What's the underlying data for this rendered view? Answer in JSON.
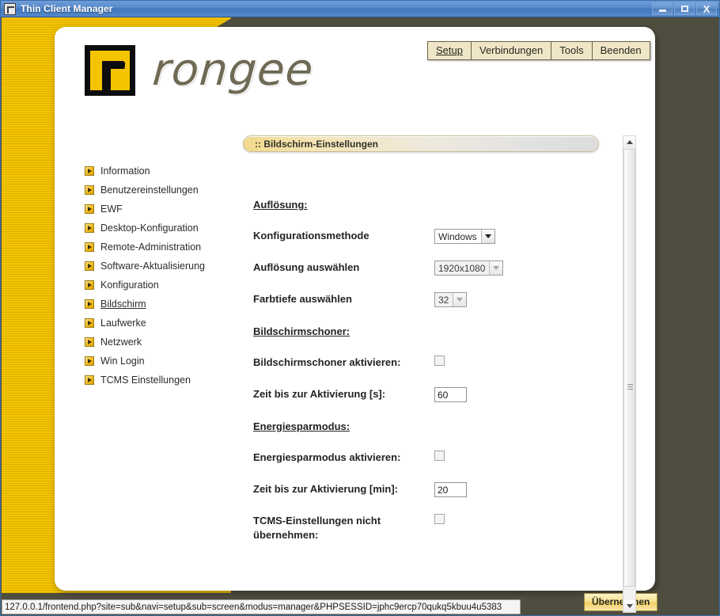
{
  "window": {
    "title": "Thin Client Manager",
    "icon": "app-logo-icon",
    "controls": {
      "minimize": "minimize-icon",
      "maximize": "maximize-icon",
      "close": "X"
    }
  },
  "brand": {
    "logo_text": "rongee",
    "logo_mark": "rongee-r-mark"
  },
  "top_menu": [
    {
      "label": "Setup",
      "active": true
    },
    {
      "label": "Verbindungen",
      "active": false
    },
    {
      "label": "Tools",
      "active": false
    },
    {
      "label": "Beenden",
      "active": false
    }
  ],
  "sidebar": {
    "items": [
      {
        "label": "Information",
        "active": false
      },
      {
        "label": "Benutzereinstellungen",
        "active": false
      },
      {
        "label": "EWF",
        "active": false
      },
      {
        "label": "Desktop-Konfiguration",
        "active": false
      },
      {
        "label": "Remote-Administration",
        "active": false
      },
      {
        "label": "Software-Aktualisierung",
        "active": false
      },
      {
        "label": "Konfiguration",
        "active": false
      },
      {
        "label": "Bildschirm",
        "active": true
      },
      {
        "label": "Laufwerke",
        "active": false
      },
      {
        "label": "Netzwerk",
        "active": false
      },
      {
        "label": "Win Login",
        "active": false
      },
      {
        "label": "TCMS Einstellungen",
        "active": false
      }
    ]
  },
  "content": {
    "header_title": ":: Bildschirm-Einstellungen",
    "sections": {
      "resolution": {
        "heading": "Auflösung:",
        "config_method": {
          "label": "Konfigurationsmethode",
          "value": "Windows",
          "options": [
            "Windows"
          ],
          "disabled": false
        },
        "resolution_select": {
          "label": "Auflösung auswählen",
          "value": "1920x1080",
          "options": [
            "1920x1080"
          ],
          "disabled": true
        },
        "color_depth": {
          "label": "Farbtiefe auswählen",
          "value": "32",
          "options": [
            "32"
          ],
          "disabled": true
        }
      },
      "screensaver": {
        "heading": "Bildschirmschoner:",
        "enable": {
          "label": "Bildschirmschoner aktivieren:",
          "checked": false
        },
        "timeout": {
          "label": "Zeit bis zur Aktivierung [s]:",
          "value": "60"
        }
      },
      "powersave": {
        "heading": "Energiesparmodus:",
        "enable": {
          "label": "Energiesparmodus aktivieren:",
          "checked": false
        },
        "timeout": {
          "label": "Zeit bis zur Aktivierung [min]:",
          "value": "20"
        },
        "ignore_tcms": {
          "label": "TCMS-Einstellungen nicht übernehmen:",
          "checked": false
        }
      }
    },
    "apply_button": "Übernehmen"
  },
  "scrollbar": {
    "up_icon": "chevron-up-icon",
    "down_icon": "chevron-down-icon"
  },
  "statusbar": {
    "url": "127.0.0.1/frontend.php?site=sub&navi=setup&sub=screen&modus=manager&PHPSESSID=jphc9ercp70qukq5kbuu4u5383"
  },
  "colors": {
    "brand_yellow": "#f5c400",
    "background_olive": "#4f4d3f",
    "titlebar_blue": "#4a7ebb",
    "menu_cream": "#efe6c8"
  }
}
